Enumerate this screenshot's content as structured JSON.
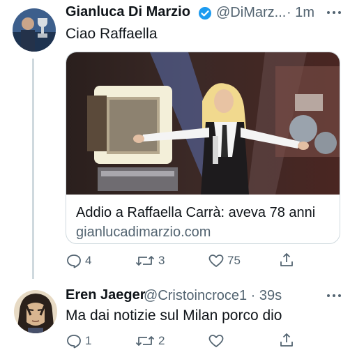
{
  "tweets": [
    {
      "name": "Gianluca Di Marzio",
      "handle": "@DiMarz...",
      "time": "· 1m",
      "text": "Ciao Raffaella",
      "card": {
        "title": "Addio a Raffaella Carrà: aveva 78 anni",
        "domain": "gianlucadimarzio.com"
      },
      "actions": {
        "replies": "4",
        "retweets": "3",
        "likes": "75"
      }
    },
    {
      "name": "Eren Jaeger",
      "handle": "@Cristoincroce1 · 39s",
      "text": "Ma dai notizie sul Milan porco dio",
      "actions": {
        "replies": "1",
        "retweets": "2"
      }
    }
  ],
  "icons": {
    "verified": "verified-badge-icon",
    "more": "more-horizontal-icon",
    "reply": "reply-icon",
    "retweet": "retweet-icon",
    "like": "heart-icon",
    "share": "share-icon"
  },
  "colors": {
    "text": "#0f1419",
    "muted": "#536471",
    "verified": "#1d9bf0",
    "border": "#cfd9de"
  }
}
